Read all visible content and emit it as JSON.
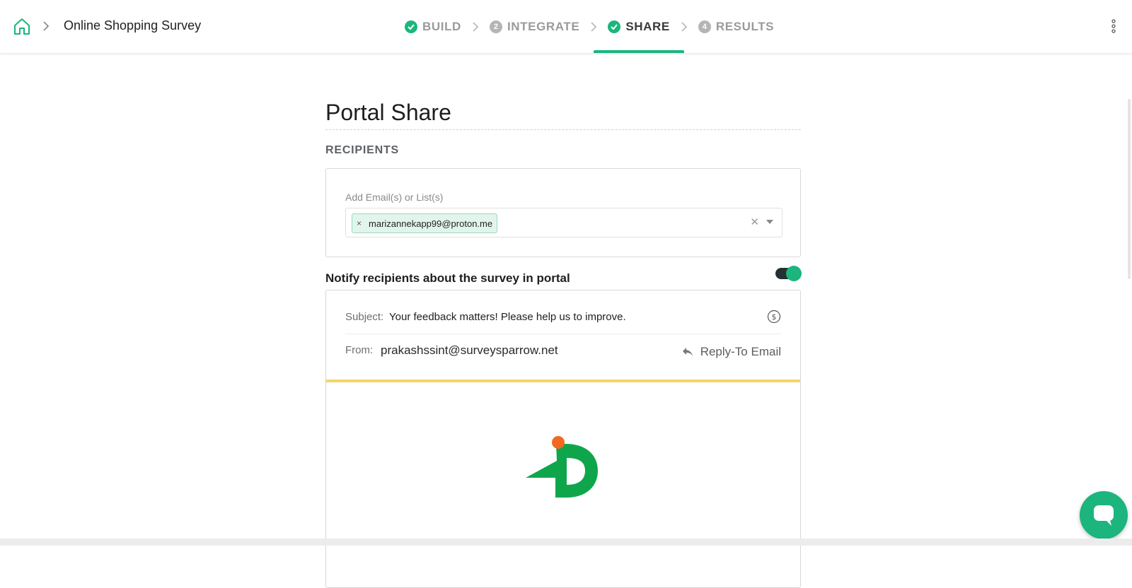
{
  "header": {
    "survey_title": "Online Shopping Survey",
    "steps": [
      {
        "label": "BUILD",
        "badge": "",
        "state": "done"
      },
      {
        "label": "INTEGRATE",
        "badge": "2",
        "state": "pending"
      },
      {
        "label": "SHARE",
        "badge": "",
        "state": "active"
      },
      {
        "label": "RESULTS",
        "badge": "4",
        "state": "pending"
      }
    ],
    "icons": {
      "home": "home-icon",
      "menu": "kebab-menu-icon"
    }
  },
  "main": {
    "page_title": "Portal Share",
    "recipients_heading": "RECIPIENTS",
    "add_label": "Add Email(s) or List(s)",
    "selected_emails": [
      "marizannekapp99@proton.me"
    ],
    "notify_label": "Notify recipients about the survey in portal",
    "notify_enabled": true,
    "email": {
      "subject_label": "Subject:",
      "subject_value": "Your feedback matters! Please help us to improve.",
      "from_label": "From:",
      "from_value": "prakashssint@surveysparrow.net",
      "reply_to_label": "Reply-To Email"
    }
  },
  "colors": {
    "accent": "#1bb57d",
    "email_accent_bar": "#f6d36a",
    "logo_green": "#0fa64b",
    "logo_orange": "#f26a21"
  }
}
